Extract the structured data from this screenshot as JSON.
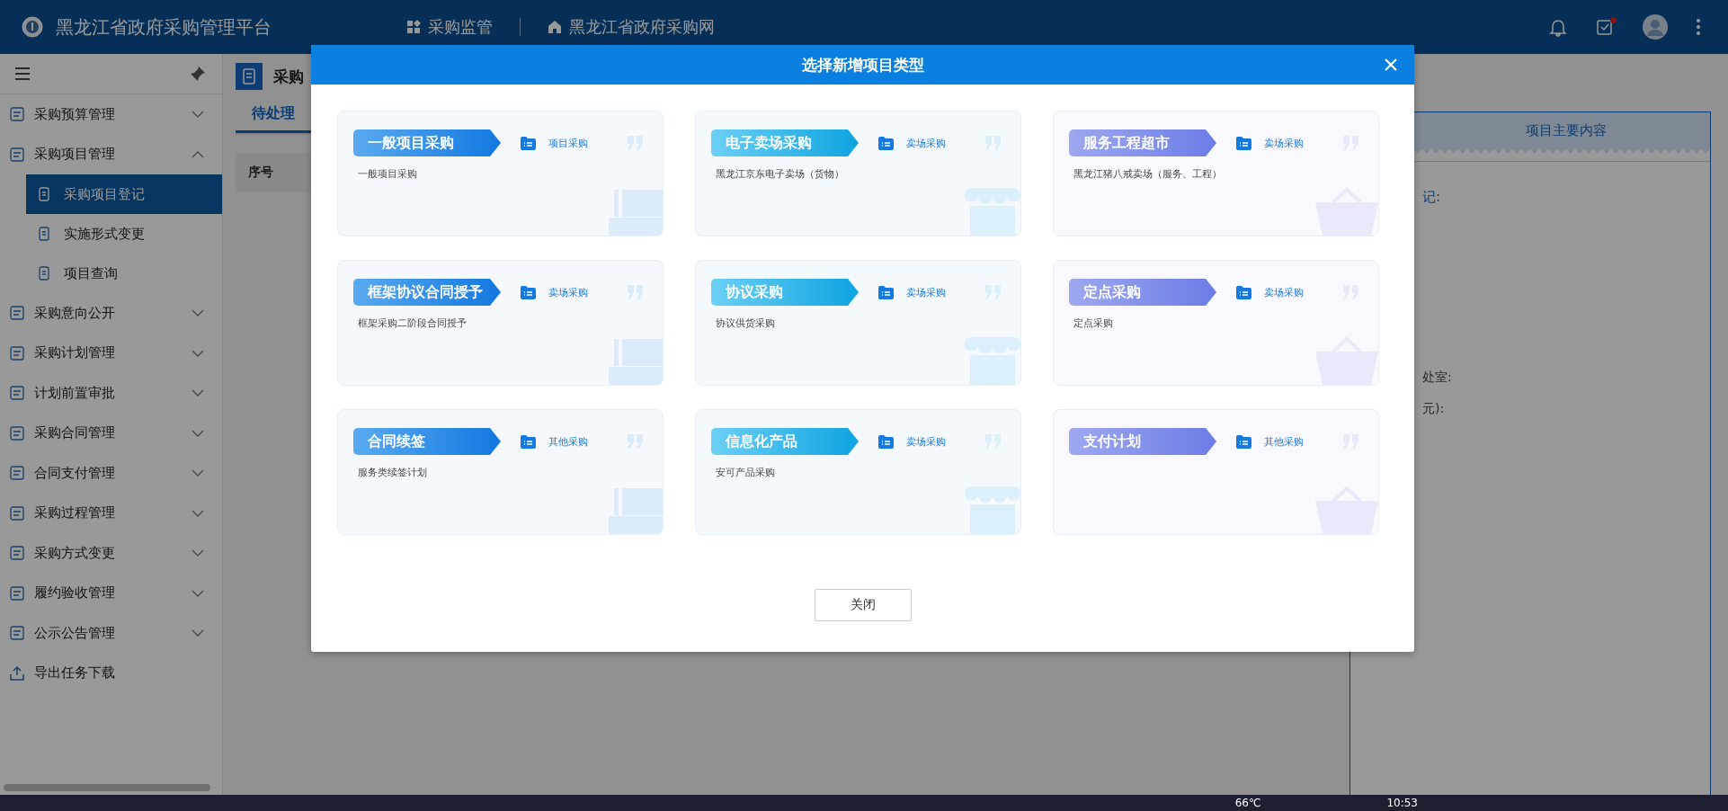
{
  "header": {
    "title": "黑龙江省政府采购管理平台",
    "nav": [
      "采购监管",
      "黑龙江省政府采购网"
    ],
    "task_badge": true
  },
  "sidebar": {
    "items": [
      {
        "label": "采购预算管理",
        "kind": "group",
        "expanded": false
      },
      {
        "label": "采购项目管理",
        "kind": "group",
        "expanded": true,
        "children": [
          {
            "label": "采购项目登记",
            "selected": true
          },
          {
            "label": "实施形式变更",
            "selected": false
          },
          {
            "label": "项目查询",
            "selected": false
          }
        ]
      },
      {
        "label": "采购意向公开",
        "kind": "group",
        "expanded": false
      },
      {
        "label": "采购计划管理",
        "kind": "group",
        "expanded": false
      },
      {
        "label": "计划前置审批",
        "kind": "group",
        "expanded": false
      },
      {
        "label": "采购合同管理",
        "kind": "group",
        "expanded": false
      },
      {
        "label": "合同支付管理",
        "kind": "group",
        "expanded": false
      },
      {
        "label": "采购过程管理",
        "kind": "group",
        "expanded": false
      },
      {
        "label": "采购方式变更",
        "kind": "group",
        "expanded": false
      },
      {
        "label": "履约验收管理",
        "kind": "group",
        "expanded": false
      },
      {
        "label": "公示公告管理",
        "kind": "group",
        "expanded": false
      },
      {
        "label": "导出任务下载",
        "kind": "link"
      }
    ]
  },
  "page": {
    "title": "采购",
    "tabs": [
      {
        "label": "待处理",
        "selected": true
      }
    ],
    "table": {
      "columns": [
        "序号"
      ]
    }
  },
  "side_panel": {
    "title": "项目主要内容",
    "labels": [
      "记:",
      "处室:",
      "元):"
    ]
  },
  "dialog": {
    "title": "选择新增项目类型",
    "cards": [
      {
        "name": "一般项目采购",
        "category": "项目采购",
        "description": "一般项目采购",
        "kind": "project"
      },
      {
        "name": "电子卖场采购",
        "category": "卖场采购",
        "description": "黑龙江京东电子卖场（货物）",
        "kind": "mall"
      },
      {
        "name": "服务工程超市",
        "category": "卖场采购",
        "description": "黑龙江猪八戒卖场（服务、工程）",
        "kind": "market"
      },
      {
        "name": "框架协议合同授予",
        "category": "卖场采购",
        "description": "框架采购二阶段合同授予",
        "kind": "project"
      },
      {
        "name": "协议采购",
        "category": "卖场采购",
        "description": "协议供货采购",
        "kind": "mall"
      },
      {
        "name": "定点采购",
        "category": "卖场采购",
        "description": "定点采购",
        "kind": "market"
      },
      {
        "name": "合同续签",
        "category": "其他采购",
        "description": "服务类续签计划",
        "kind": "project"
      },
      {
        "name": "信息化产品",
        "category": "卖场采购",
        "description": "安可产品采购",
        "kind": "mall"
      },
      {
        "name": "支付计划",
        "category": "其他采购",
        "kind": "market"
      }
    ],
    "button": "关闭"
  },
  "taskbar": {
    "temperature": "66℃",
    "time": "10:53"
  }
}
